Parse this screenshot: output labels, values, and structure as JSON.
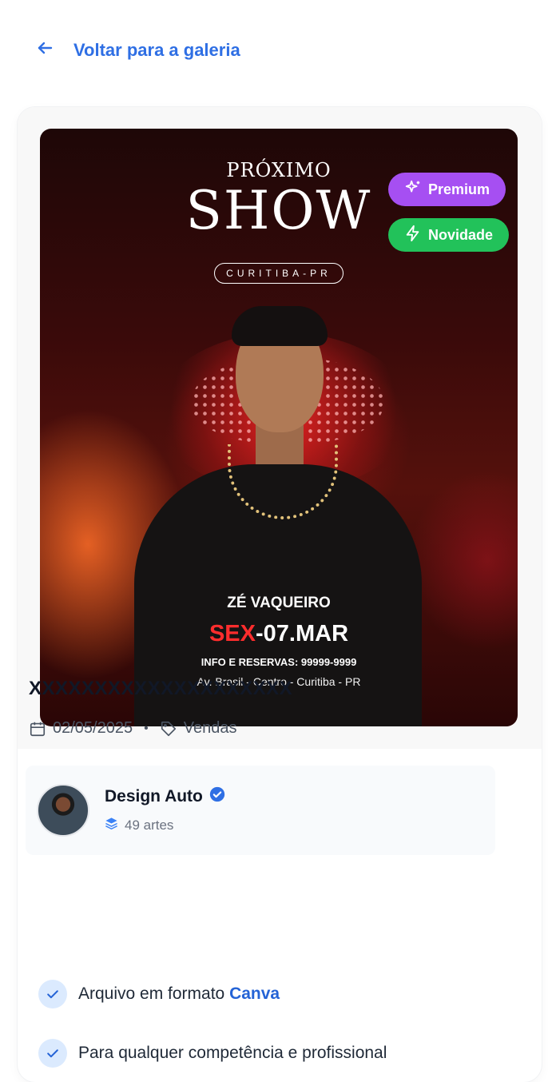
{
  "back": {
    "label": "Voltar para a galeria"
  },
  "poster": {
    "pre_title": "PRÓXIMO",
    "title": "SHOW",
    "city": "CURITIBA-PR",
    "artist": "ZÉ VAQUEIRO",
    "date_day": "SEX",
    "date_rest": "-07.MAR",
    "info": "INFO E RESERVAS: 99999-9999",
    "address": "Av. Brasil - Centro - Curitiba - PR"
  },
  "badges": {
    "premium": "Premium",
    "new": "Novidade"
  },
  "item": {
    "title": "XXXXXXXXXXXXXXXXXXXX",
    "date": "02/05/2025",
    "separator": "•",
    "category": "Vendas"
  },
  "author": {
    "name": "Design Auto",
    "count": "49 artes"
  },
  "features": [
    {
      "prefix": "Arquivo em formato ",
      "highlight": "Canva"
    },
    {
      "text": "Para qualquer competência e profissional"
    }
  ],
  "colors": {
    "accent": "#2f6fe4",
    "premium": "#a64ff2",
    "new": "#22c25a"
  }
}
